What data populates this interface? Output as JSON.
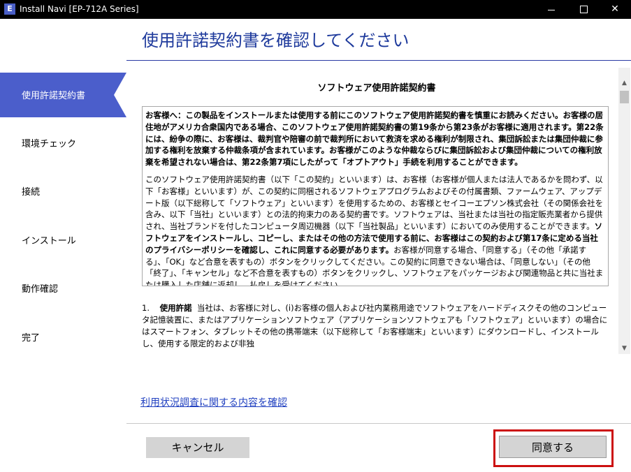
{
  "window": {
    "app_icon": "E",
    "title": "Install Navi [EP-712A Series]",
    "controls": {
      "minimize": "",
      "maximize": "",
      "close": "✕"
    }
  },
  "sidebar": {
    "items": [
      {
        "label": "使用許諾契約書",
        "active": true
      },
      {
        "label": "環境チェック",
        "active": false
      },
      {
        "label": "接続",
        "active": false
      },
      {
        "label": "インストール",
        "active": false
      },
      {
        "label": "動作確認",
        "active": false
      },
      {
        "label": "完了",
        "active": false
      }
    ]
  },
  "page": {
    "title": "使用許諾契約書を確認してください"
  },
  "eula": {
    "title": "ソフトウェア使用許諾契約書",
    "notice": "お客様へ：この製品をインストールまたは使用する前にこのソフトウェア使用許諾契約書を慎重にお読みください。お客様の居住地がアメリカ合衆国内である場合、このソフトウェア使用許諾契約書の第19条から第23条がお客様に適用されます。第22条には、紛争の際に、お客様は、裁判官や陪審の前で裁判所において救済を求める権利が制限され、集団訴訟または集団仲裁に参加する権利を放棄する仲裁条項が含まれています。お客様がこのような仲裁ならびに集団訴訟および集団仲裁についての権利放棄を希望されない場合は、第22条第7項にしたがって「オプトアウト」手続を利用することができます。",
    "body_1": "このソフトウェア使用許諾契約書（以下「この契約」といいます）は、お客様（お客様が個人または法人であるかを問わず、以下「お客様」といいます）が、この契約に同梱されるソフトウェアプログラムおよびその付属書類、ファームウェア、アップデート版（以下総称して「ソフトウェア」といいます）を使用するための、お客様とセイコーエプソン株式会社（その関係会社を含み、以下「当社」といいます）との法的拘束力のある契約書です。ソフトウェアは、当社または当社の指定販売業者から提供され、当社ブランドを付したコンピュータ周辺機器（以下「当社製品」といいます）においてのみ使用することができます。",
    "body_bold": "ソフトウェアをインストールし、コピーし、またはその他の方法で使用する前に、お客様はこの契約および第17条に定める当社のプライバシーポリシーを確認し、これに同意する必要があります。",
    "body_2": "お客様が同意する場合、「同意する」（その他「承諾する」、「OK」など合意を表すもの）ボタンをクリックしてください。この契約に同意できない場合は、「同意しない」（その他「終了」、「キャンセル」など不合意を表すもの）ボタンをクリックし、ソフトウェアをパッケージおよび関連物品と共に当社または購入した店舗に返却し、払戻しを受けてください。",
    "section1_num": "1.",
    "section1_head": "使用許諾",
    "section1_text": "当社は、お客様に対し、(i)お客様の個人および社内業務用途でソフトウェアをハードディスクその他のコンピュータ記憶装置に、またはアプリケーションソフトウェア（アプリケーションソフトウェアも「ソフトウェア」といいます）の場合にはスマートフォン、タブレットその他の携帯端末（以下総称して「お客様端末」といいます）にダウンロードし、インストールし、使用する限定的および非独"
  },
  "links": {
    "usage_survey": "利用状況調査に関する内容を確認"
  },
  "buttons": {
    "cancel": "キャンセル",
    "agree": "同意する"
  },
  "scrollbar": {
    "up_icon": "▲",
    "down_icon": "▼"
  },
  "colors": {
    "accent": "#4b5ecb",
    "title": "#1e3a9c",
    "highlight": "#cc1010"
  }
}
